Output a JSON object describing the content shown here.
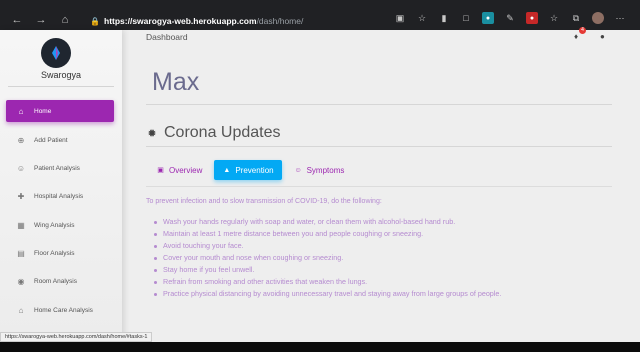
{
  "browser": {
    "url_host": "https://swarogya-web.herokuapp.com",
    "url_path": "/dash/home/"
  },
  "sidebar": {
    "brand": "Swarogya",
    "items": [
      {
        "label": "Home",
        "icon": "home-icon",
        "active": true
      },
      {
        "label": "Add Patient",
        "icon": "plus-circle-icon"
      },
      {
        "label": "Patient Analysis",
        "icon": "person-icon"
      },
      {
        "label": "Hospital Analysis",
        "icon": "hospital-icon"
      },
      {
        "label": "Wing Analysis",
        "icon": "building-icon"
      },
      {
        "label": "Floor Analysis",
        "icon": "floor-icon"
      },
      {
        "label": "Room Analysis",
        "icon": "location-icon"
      },
      {
        "label": "Home Care Analysis",
        "icon": "house-icon"
      }
    ]
  },
  "header": {
    "breadcrumb": "Dashboard",
    "notification_count": "4"
  },
  "main": {
    "title": "Max",
    "section_title": "Corona Updates",
    "tabs": [
      {
        "label": "Overview",
        "icon": "overview-icon"
      },
      {
        "label": "Prevention",
        "icon": "prevention-icon",
        "active": true
      },
      {
        "label": "Symptoms",
        "icon": "symptoms-icon"
      }
    ],
    "intro": "To prevent infection and to slow transmission of COVID-19, do the following:",
    "bullets": [
      "Wash your hands regularly with soap and water, or clean them with alcohol-based hand rub.",
      "Maintain at least 1 metre distance between you and people coughing or sneezing.",
      "Avoid touching your face.",
      "Cover your mouth and nose when coughing or sneezing.",
      "Stay home if you feel unwell.",
      "Refrain from smoking and other activities that weaken the lungs.",
      "Practice physical distancing by avoiding unnecessary travel and staying away from large groups of people."
    ]
  },
  "status_bar": "https://swarogya-web.herokuapp.com/dash/home/#tasks-1",
  "colors": {
    "accent": "#9c27b0",
    "tab_active": "#03a9f4",
    "title": "#6b6b8e",
    "bullet_text": "#b58bd0"
  }
}
